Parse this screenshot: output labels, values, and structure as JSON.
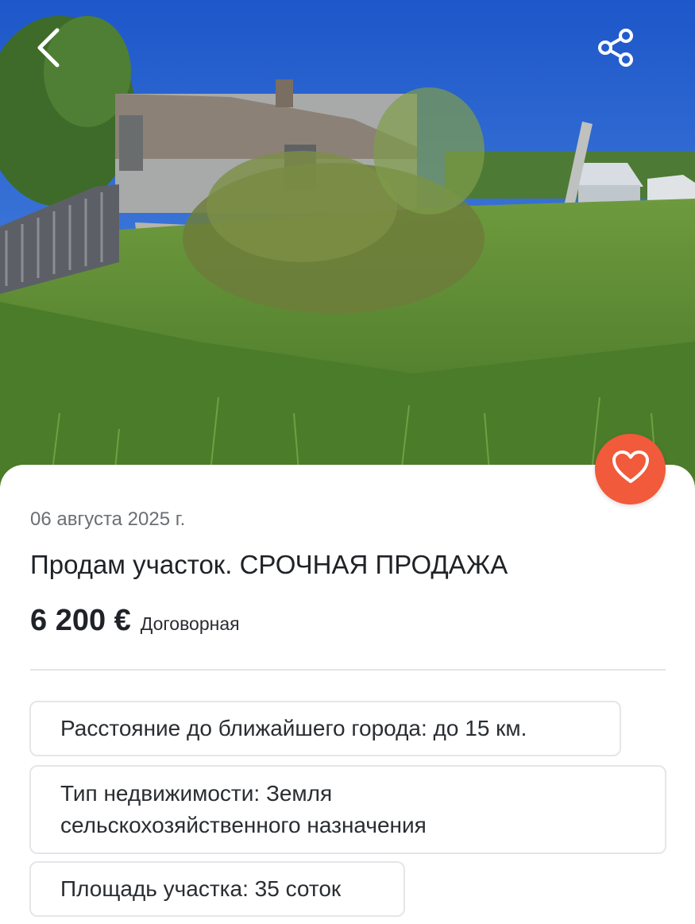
{
  "listing": {
    "date": "06 августа 2025 г.",
    "title": "Продам участок. СРОЧНАЯ ПРОДАЖА",
    "price": "6 200 €",
    "price_note": "Договорная"
  },
  "attributes": [
    "Расстояние до ближайшего города: до 15 км.",
    "Тип недвижимости: Земля сельскохозяйственного назначения",
    "Площадь участка: 35 соток"
  ],
  "icons": {
    "back": "chevron-left-icon",
    "share": "share-icon",
    "favorite": "heart-icon"
  },
  "colors": {
    "favorite_button": "#f15a3a",
    "text_primary": "#1f2226",
    "text_secondary": "#6b6f73",
    "border": "#e4e6e9"
  }
}
